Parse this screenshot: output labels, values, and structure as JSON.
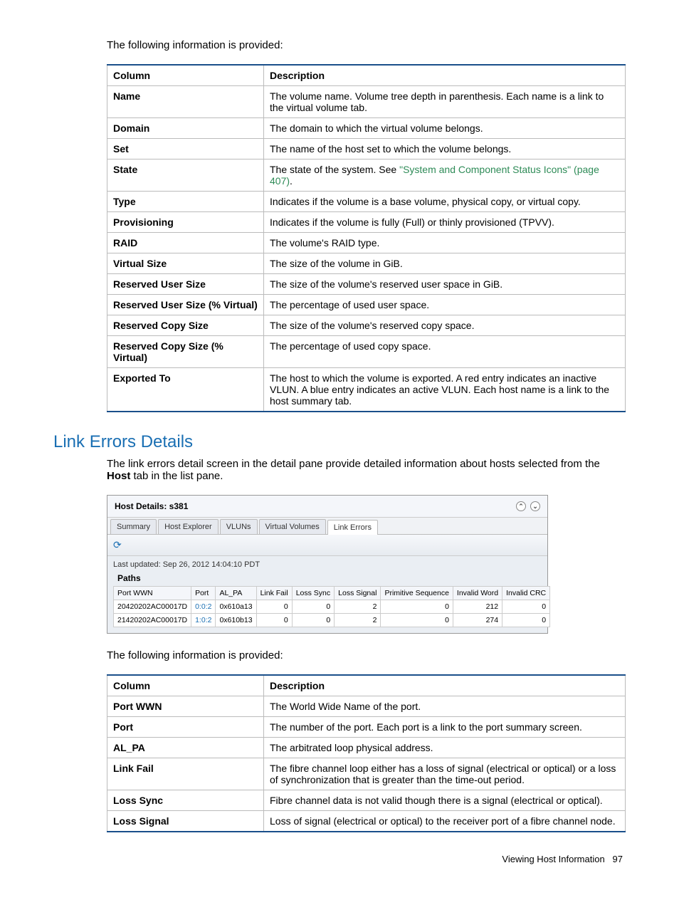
{
  "intro1": "The following information is provided:",
  "table1": {
    "head": {
      "col": "Column",
      "desc": "Description"
    },
    "rows": [
      {
        "c": "Name",
        "d": "The volume name. Volume tree depth in parenthesis. Each name is a link to the virtual volume tab."
      },
      {
        "c": "Domain",
        "d": "The domain to which the virtual volume belongs."
      },
      {
        "c": "Set",
        "d": "The name of the host set to which the volume belongs."
      },
      {
        "c": "State",
        "d_pre": "The state of the system. See ",
        "d_link": "\"System and Component Status Icons\" (page 407)",
        "d_post": "."
      },
      {
        "c": "Type",
        "d": "Indicates if the volume is a base volume, physical copy, or virtual copy."
      },
      {
        "c": "Provisioning",
        "d": "Indicates if the volume is fully (Full) or thinly provisioned (TPVV)."
      },
      {
        "c": "RAID",
        "d": "The volume's RAID type."
      },
      {
        "c": "Virtual Size",
        "d": "The size of the volume in GiB."
      },
      {
        "c": "Reserved User Size",
        "d": "The size of the volume's reserved user space in GiB."
      },
      {
        "c": "Reserved User Size (% Virtual)",
        "d": "The percentage of used user space."
      },
      {
        "c": "Reserved Copy Size",
        "d": "The size of the volume's reserved copy space."
      },
      {
        "c": "Reserved Copy Size (% Virtual)",
        "d": "The percentage of used copy space."
      },
      {
        "c": "Exported To",
        "d": "The host to which the volume is exported. A red entry indicates an inactive VLUN. A blue entry indicates an active VLUN. Each host name is a link to the host summary tab."
      }
    ]
  },
  "section_heading": "Link Errors Details",
  "section_text_pre": "The link errors detail screen in the detail pane provide detailed information about hosts selected from the ",
  "section_text_bold": "Host",
  "section_text_post": " tab in the list pane.",
  "panel": {
    "title": "Host Details: s381",
    "tabs": [
      "Summary",
      "Host Explorer",
      "VLUNs",
      "Virtual Volumes",
      "Link Errors"
    ],
    "selected_tab": 4,
    "last_updated": "Last updated: Sep 26, 2012 14:04:10 PDT",
    "paths_label": "Paths",
    "columns": [
      "Port WWN",
      "Port",
      "AL_PA",
      "Link Fail",
      "Loss Sync",
      "Loss Signal",
      "Primitive Sequence",
      "Invalid Word",
      "Invalid CRC"
    ],
    "rows": [
      {
        "wwn": "20420202AC00017D",
        "port": "0:0:2",
        "alpa": "0x610a13",
        "linkfail": "0",
        "losssync": "0",
        "losssignal": "2",
        "prim": "0",
        "invword": "212",
        "invcrc": "0"
      },
      {
        "wwn": "21420202AC00017D",
        "port": "1:0:2",
        "alpa": "0x610b13",
        "linkfail": "0",
        "losssync": "0",
        "losssignal": "2",
        "prim": "0",
        "invword": "274",
        "invcrc": "0"
      }
    ]
  },
  "intro2": "The following information is provided:",
  "table2": {
    "head": {
      "col": "Column",
      "desc": "Description"
    },
    "rows": [
      {
        "c": "Port WWN",
        "d": "The World Wide Name of the port."
      },
      {
        "c": "Port",
        "d": "The number of the port. Each port is a link to the port summary screen."
      },
      {
        "c": "AL_PA",
        "d": "The arbitrated loop physical address."
      },
      {
        "c": "Link Fail",
        "d": "The fibre channel loop either has a loss of signal (electrical or optical) or a loss of synchronization that is greater than the time-out period."
      },
      {
        "c": "Loss Sync",
        "d": "Fibre channel data is not valid though there is a signal (electrical or optical)."
      },
      {
        "c": "Loss Signal",
        "d": "Loss of signal (electrical or optical) to the receiver port of a fibre channel node."
      }
    ]
  },
  "footer": {
    "text": "Viewing Host Information",
    "page": "97"
  }
}
